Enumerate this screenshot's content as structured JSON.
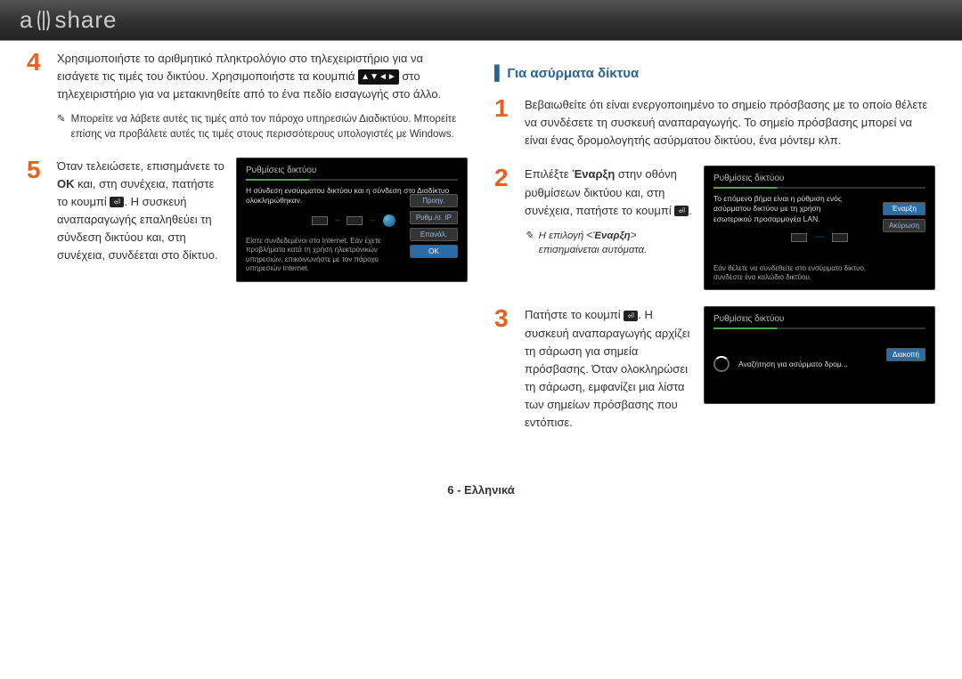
{
  "logo_text": "a)|(share",
  "left": {
    "step4": {
      "num": "4",
      "text1": "Χρησιμοποιήστε το αριθμητικό πληκτρολόγιο στο τηλεχειριστήριο για να εισάγετε τις τιμές του δικτύου. Χρησιμοποιήστε τα κουμπιά",
      "arrows": "▲▼◄►",
      "text2": "στο τηλεχειριστήριο για να μετακινηθείτε από το ένα πεδίο εισαγωγής στο άλλο.",
      "note": "Μπορείτε να λάβετε αυτές τις τιμές από τον πάροχο υπηρεσιών Διαδικτύου. Μπορείτε επίσης να προβάλετε αυτές τις τιμές στους περισσότερους υπολογιστές με Windows."
    },
    "step5": {
      "num": "5",
      "text1": "Όταν τελειώσετε, επισημάνετε το ",
      "bold_ok": "OK",
      "text2": " και, στη συνέχεια, πατήστε το κουμπί ",
      "text3": ". Η συσκευή αναπαραγωγής επαληθεύει τη σύνδεση δικτύου και, στη συνέχεια, συνδέεται στο δίκτυο.",
      "ss": {
        "title": "Ρυθμίσεις δικτύου",
        "msg": "Η σύνδεση ενσύρματου δικτύου και η σύνδεση στο Διαδίκτυο ολοκληρώθηκαν.",
        "btn1": "Προηγ.",
        "btn2": "Ρυθμ./σ. IP",
        "btn3": "Επανάλ.",
        "btn4": "OK",
        "footer": "Είστε συνδεδεμένοι στο Internet. Εάν έχετε προβλήματα κατά τη χρήση ηλεκτρονικών υπηρεσιών, επικοινωνήστε με τον πάροχο υπηρεσιών Internet."
      }
    }
  },
  "right": {
    "title": "Για ασύρματα δίκτυα",
    "step1": {
      "num": "1",
      "text": "Βεβαιωθείτε ότι είναι ενεργοποιημένο το σημείο πρόσβασης με το οποίο θέλετε να συνδέσετε τη συσκευή αναπαραγωγής. Το σημείο πρόσβασης μπορεί να είναι ένας δρομολογητής ασύρματου δικτύου, ένα μόντεμ κλπ."
    },
    "step2": {
      "num": "2",
      "text1": "Επιλέξτε ",
      "bold1": "Έναρξη",
      "text2": " στην οθόνη ρυθμίσεων δικτύου και, στη συνέχεια, πατήστε το κουμπί ",
      "note_pre": "Η επιλογή <",
      "note_bold": "Έναρξη",
      "note_post": "> επισημαίνεται αυτόματα.",
      "ss": {
        "title": "Ρυθμίσεις δικτύου",
        "msg": "Το επόμενο βήμα είναι η ρύθμιση ενός ασύρματου δικτύου με τη χρήση εσωτερικού προσαρμογέα LAN.",
        "btn_start": "Έναρξη",
        "btn_cancel": "Ακύρωση",
        "footer": "Εάν θέλετε να συνδεθείτε στο ενσύρματο δίκτυο, συνδέστε ένα καλώδιο δικτύου."
      }
    },
    "step3": {
      "num": "3",
      "text1": "Πατήστε το κουμπί ",
      "text2": ". Η συσκευή αναπαραγωγής αρχίζει τη σάρωση για σημεία πρόσβασης. Όταν ολοκληρώσει τη σάρωση, εμφανίζει μια λίστα των σημείων πρόσβασης που εντόπισε.",
      "ss": {
        "title": "Ρυθμίσεις δικτύου",
        "msg": "Αναζήτηση για ασύρματο δρομ...",
        "btn_stop": "Διακοπή"
      }
    }
  },
  "footer": "6 - Ελληνικά"
}
